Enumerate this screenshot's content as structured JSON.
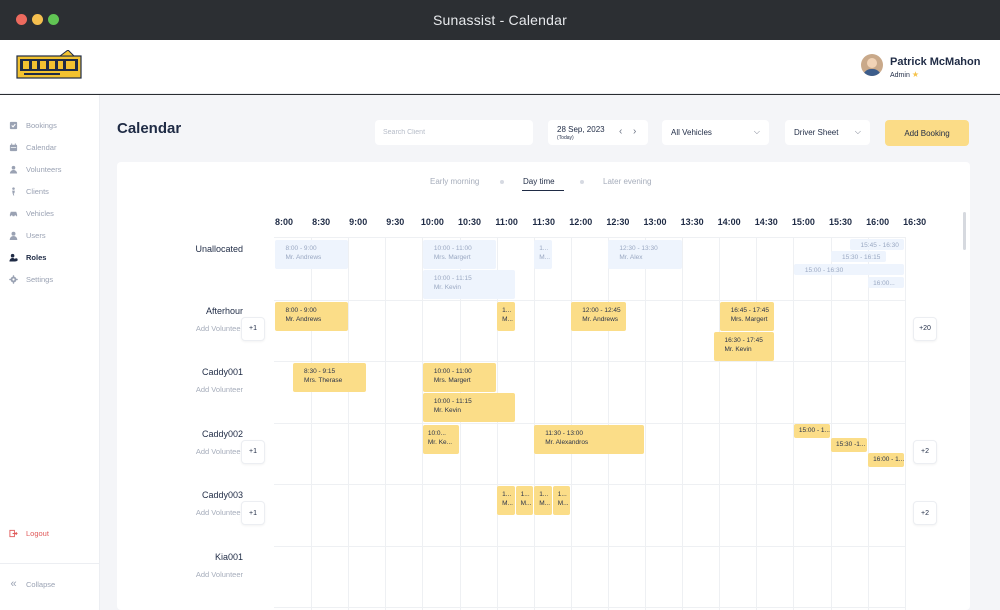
{
  "window": {
    "title": "Sunassist - Calendar"
  },
  "user": {
    "name": "Patrick McMahon",
    "role": "Admin"
  },
  "sidebar": {
    "items": [
      {
        "label": "Bookings",
        "icon": "bookings-icon",
        "active": false
      },
      {
        "label": "Calendar",
        "icon": "calendar-icon",
        "active": false
      },
      {
        "label": "Volunteers",
        "icon": "volunteers-icon",
        "active": false
      },
      {
        "label": "Clients",
        "icon": "clients-icon",
        "active": false
      },
      {
        "label": "Vehicles",
        "icon": "car-icon",
        "active": false
      },
      {
        "label": "Users",
        "icon": "user-icon",
        "active": false
      },
      {
        "label": "Roles",
        "icon": "roles-icon",
        "active": true
      },
      {
        "label": "Settings",
        "icon": "gear-icon",
        "active": false
      }
    ],
    "logout": "Logout",
    "collapse": "Collapse"
  },
  "toolbar": {
    "title": "Calendar",
    "search_placeholder": "Search Client",
    "date": "28 Sep, 2023",
    "date_sub": "(Today)",
    "vehicles": "All Vehicles",
    "driver_sheet": "Driver Sheet",
    "add_booking": "Add Booking"
  },
  "segments": [
    "Early morning",
    "Day time",
    "Later evening"
  ],
  "active_segment": "Day time",
  "hours": [
    "8:00",
    "8:30",
    "9:00",
    "9:30",
    "10:00",
    "10:30",
    "11:00",
    "11:30",
    "12:00",
    "12:30",
    "13:00",
    "13:30",
    "14:00",
    "14:30",
    "15:00",
    "15:30",
    "16:00",
    "16:30"
  ],
  "rows": [
    {
      "name": "Unallocated",
      "sub": "",
      "left_more": "",
      "right_more": ""
    },
    {
      "name": "Afterhour",
      "sub": "Add Volunteer",
      "left_more": "+1",
      "right_more": "+20"
    },
    {
      "name": "Caddy001",
      "sub": "Add Volunteer",
      "left_more": "",
      "right_more": ""
    },
    {
      "name": "Caddy002",
      "sub": "Add Volunteer",
      "left_more": "+1",
      "right_more": "+2"
    },
    {
      "name": "Caddy003",
      "sub": "Add Volunteer",
      "left_more": "+1",
      "right_more": "+2"
    },
    {
      "name": "Kia001",
      "sub": "Add Volunteer",
      "left_more": "",
      "right_more": ""
    }
  ],
  "events": [
    {
      "row": 0,
      "start": "8:00",
      "end": "9:00",
      "lane": 0,
      "time": "8:00 - 9:00",
      "name": "Mr. Andrews",
      "style": "b"
    },
    {
      "row": 0,
      "start": "10:00",
      "end": "11:00",
      "lane": 0,
      "time": "10:00 - 11:00",
      "name": "Mrs. Margert",
      "style": "b"
    },
    {
      "row": 0,
      "start": "11:30",
      "end": "11:45",
      "lane": 0,
      "time": "1...",
      "name": "M...",
      "style": "b"
    },
    {
      "row": 0,
      "start": "12:30",
      "end": "13:30",
      "lane": 0,
      "time": "12:30 - 13:30",
      "name": "Mr. Alex",
      "style": "b"
    },
    {
      "row": 0,
      "start": "10:00",
      "end": "11:15",
      "lane": 1,
      "time": "10:00 - 11:15",
      "name": "Mr. Kevin",
      "style": "b"
    },
    {
      "row": 0,
      "start": "15:45",
      "end": "16:30",
      "lane": "s0",
      "time": "15:45 - 16:30",
      "name": "",
      "style": "b"
    },
    {
      "row": 0,
      "start": "15:30",
      "end": "16:15",
      "lane": "s1",
      "time": "15:30 - 16:15",
      "name": "",
      "style": "b"
    },
    {
      "row": 0,
      "start": "15:00",
      "end": "16:30",
      "lane": "s2",
      "time": "15:00 - 16:30",
      "name": "",
      "style": "b"
    },
    {
      "row": 0,
      "start": "16:00",
      "end": "16:30",
      "lane": "s3",
      "time": "16:00...",
      "name": "",
      "style": "b"
    },
    {
      "row": 1,
      "start": "8:00",
      "end": "9:00",
      "lane": 0,
      "time": "8:00 - 9:00",
      "name": "Mr. Andrews",
      "style": "y"
    },
    {
      "row": 1,
      "start": "11:00",
      "end": "11:15",
      "lane": 0,
      "time": "1...",
      "name": "M...",
      "style": "y"
    },
    {
      "row": 1,
      "start": "12:00",
      "end": "12:45",
      "lane": 0,
      "time": "12:00 - 12:45",
      "name": "Mr. Andrews",
      "style": "y"
    },
    {
      "row": 1,
      "start": "14:00",
      "end": "14:45",
      "lane": 0,
      "time": "16:45 - 17:45",
      "name": "Mrs. Margert",
      "style": "y"
    },
    {
      "row": 1,
      "start": "13:55",
      "end": "14:45",
      "lane": 1,
      "time": "16:30 - 17:45",
      "name": "Mr. Kevin",
      "style": "y"
    },
    {
      "row": 2,
      "start": "8:15",
      "end": "9:15",
      "lane": 0,
      "time": "8:30 - 9:15",
      "name": "Mrs. Therase",
      "style": "y"
    },
    {
      "row": 2,
      "start": "10:00",
      "end": "11:00",
      "lane": 0,
      "time": "10:00 - 11:00",
      "name": "Mrs. Margert",
      "style": "y"
    },
    {
      "row": 2,
      "start": "10:00",
      "end": "11:15",
      "lane": 1,
      "time": "10:00 - 11:15",
      "name": "Mr. Kevin",
      "style": "y"
    },
    {
      "row": 3,
      "start": "10:00",
      "end": "10:30",
      "lane": 0,
      "time": "10:0...",
      "name": "Mr. Ke...",
      "style": "y"
    },
    {
      "row": 3,
      "start": "11:30",
      "end": "13:00",
      "lane": 0,
      "time": "11:30 - 13:00",
      "name": "Mr. Alexandros",
      "style": "y"
    },
    {
      "row": 3,
      "start": "15:00",
      "end": "15:30",
      "lane": "t0",
      "time": "15:00 - 1...",
      "name": "",
      "style": "y"
    },
    {
      "row": 3,
      "start": "15:30",
      "end": "16:00",
      "lane": "t1",
      "time": "15:30 -1...",
      "name": "",
      "style": "y"
    },
    {
      "row": 3,
      "start": "16:00",
      "end": "16:30",
      "lane": "t2",
      "time": "16:00 - 1...",
      "name": "",
      "style": "y"
    },
    {
      "row": 4,
      "start": "11:00",
      "end": "11:15",
      "lane": 0,
      "time": "1...",
      "name": "M...",
      "style": "y"
    },
    {
      "row": 4,
      "start": "11:15",
      "end": "11:30",
      "lane": 0,
      "time": "1...",
      "name": "M...",
      "style": "y"
    },
    {
      "row": 4,
      "start": "11:30",
      "end": "11:45",
      "lane": 0,
      "time": "1...",
      "name": "M...",
      "style": "y"
    },
    {
      "row": 4,
      "start": "11:45",
      "end": "12:00",
      "lane": 0,
      "time": "1...",
      "name": "M...",
      "style": "y"
    }
  ]
}
